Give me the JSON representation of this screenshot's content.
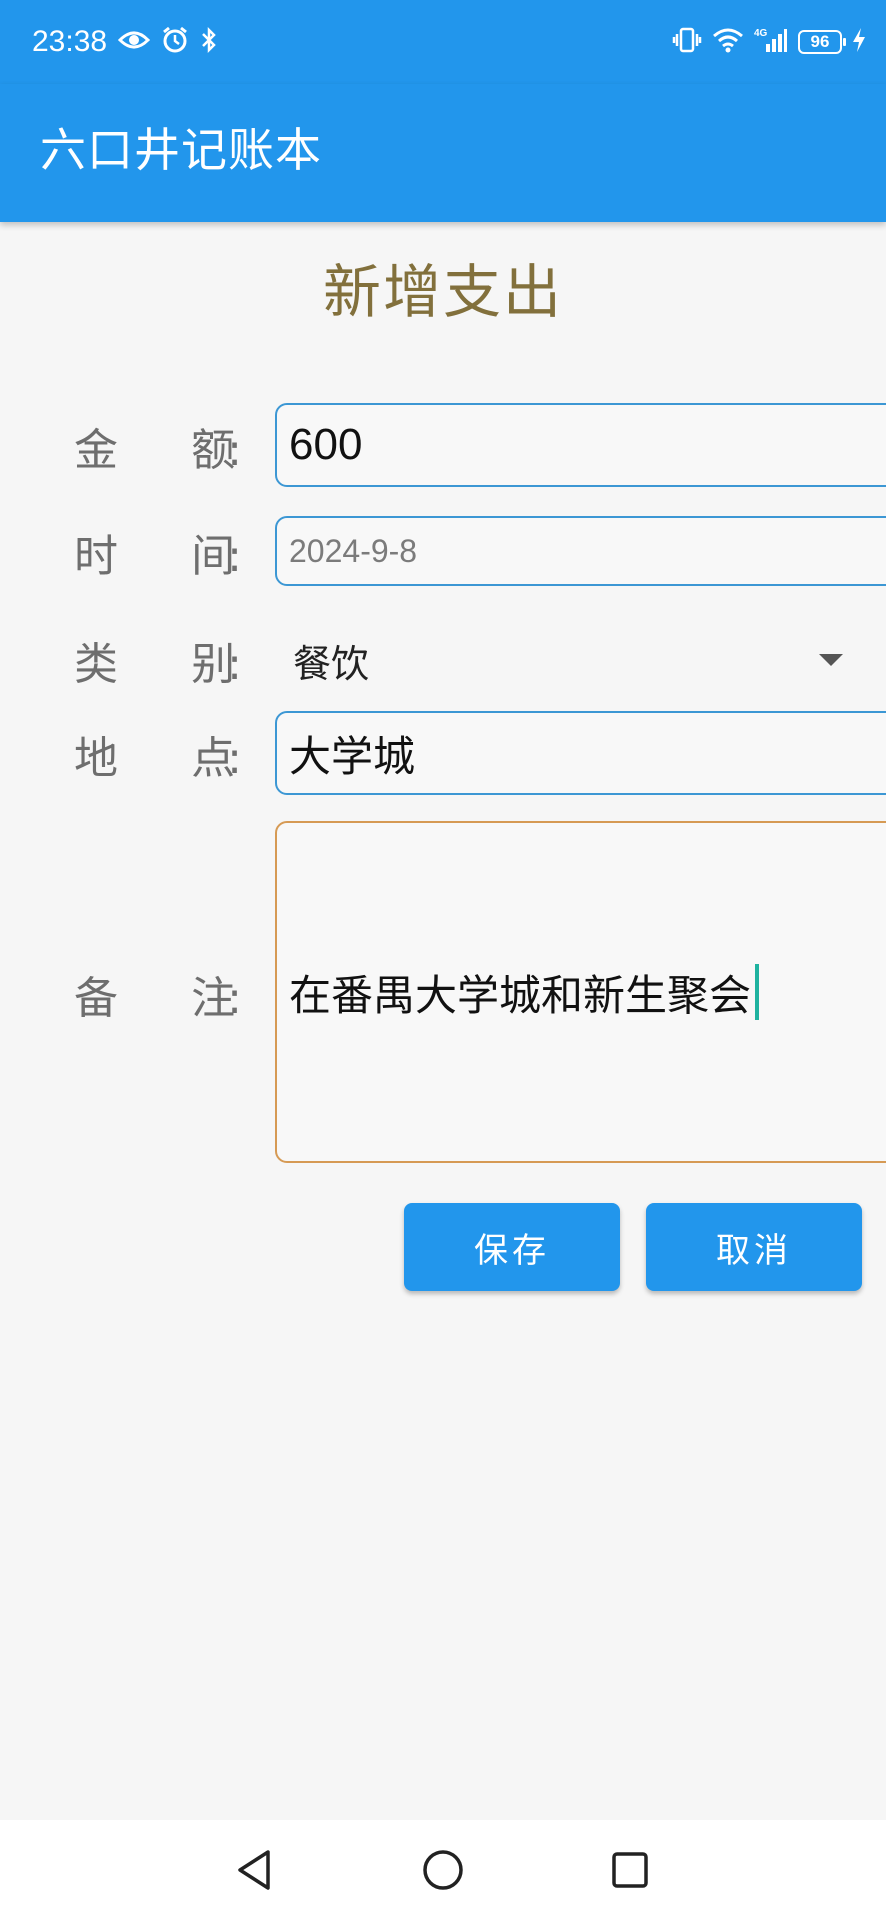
{
  "status_bar": {
    "time": "23:38",
    "battery_level": "96",
    "network": "4G"
  },
  "app_bar": {
    "title": "六口井记账本"
  },
  "form": {
    "heading": "新增支出",
    "amount": {
      "label_a": "金",
      "label_b": "额",
      "colon": ":",
      "value": "600"
    },
    "date": {
      "label_a": "时",
      "label_b": "间",
      "colon": ":",
      "value": "2024-9-8"
    },
    "category": {
      "label_a": "类",
      "label_b": "别",
      "colon": ":",
      "selected": "餐饮"
    },
    "place": {
      "label_a": "地",
      "label_b": "点",
      "colon": ":",
      "value": "大学城"
    },
    "note": {
      "label_a": "备",
      "label_b": "注",
      "colon": ":",
      "value": "在番禺大学城和新生聚会"
    }
  },
  "buttons": {
    "save": "保存",
    "cancel": "取消"
  },
  "colors": {
    "primary": "#2296ec",
    "heading": "#82703c",
    "field_border": "#3c97d4",
    "focused_border": "#d69a54",
    "caret": "#1fb3a0"
  },
  "icons": {
    "status_left": [
      "eye-icon",
      "alarm-icon",
      "bluetooth-icon"
    ],
    "status_right": [
      "vibrate-icon",
      "wifi-icon",
      "signal-icon",
      "battery-icon",
      "charging-icon"
    ],
    "nav": [
      "back-icon",
      "home-icon",
      "recents-icon"
    ]
  }
}
